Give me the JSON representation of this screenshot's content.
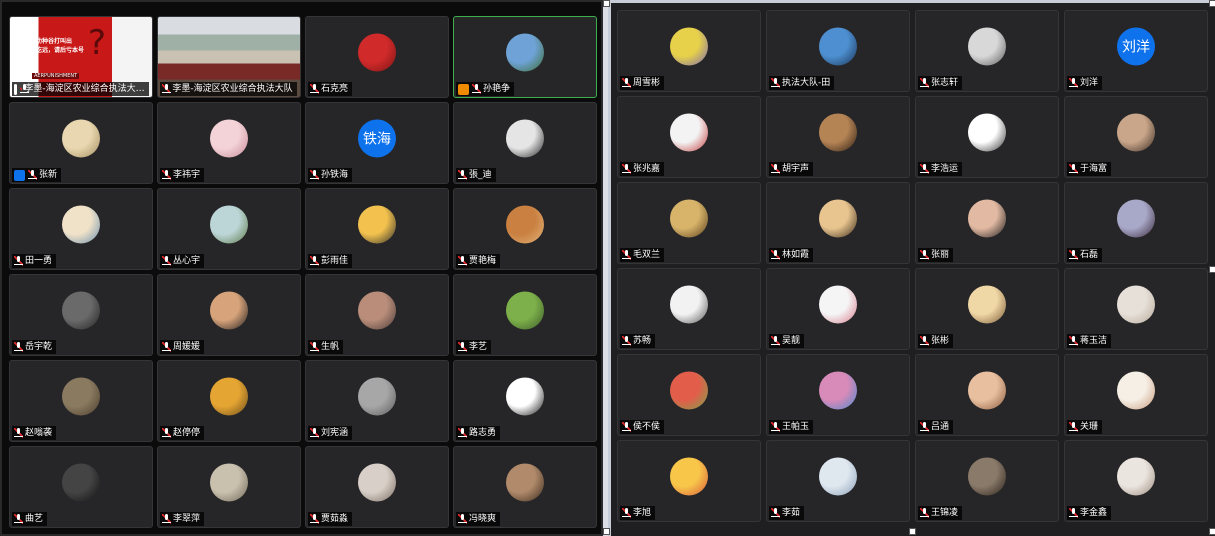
{
  "left_panel": {
    "tiles": [
      {
        "name": "李墨-海淀区农业综合执法大…",
        "avatar_type": "video_slide",
        "badge": "screen",
        "slide_text": "劝种谷打叫出\n吃远，请后亏本号",
        "slide_logo": "AERPUNISHMENT"
      },
      {
        "name": "李墨-海淀区农业综合执法大队",
        "avatar_type": "video_room"
      },
      {
        "name": "石克亮",
        "avatar_type": "photo",
        "colors": [
          "#d12a2a",
          "#7b1414"
        ]
      },
      {
        "name": "孙艳争",
        "avatar_type": "photo",
        "colors": [
          "#6fa3d8",
          "#3b6b2f"
        ],
        "badge": "orange",
        "active": true
      },
      {
        "name": "张新",
        "avatar_type": "photo",
        "colors": [
          "#e8d7b0",
          "#a58d5f"
        ],
        "badge": "blue"
      },
      {
        "name": "李祎宇",
        "avatar_type": "photo",
        "colors": [
          "#f3d3d8",
          "#c98a97"
        ]
      },
      {
        "name": "孙铁海",
        "avatar_type": "text",
        "avatar_text": "铁海"
      },
      {
        "name": "張_迪",
        "avatar_type": "photo",
        "colors": [
          "#e5e5e5",
          "#222222"
        ]
      },
      {
        "name": "田一勇",
        "avatar_type": "photo",
        "colors": [
          "#f0e2c8",
          "#6b8fae"
        ]
      },
      {
        "name": "丛心宇",
        "avatar_type": "photo",
        "colors": [
          "#bcd6d8",
          "#5c7a45"
        ]
      },
      {
        "name": "彭雨佳",
        "avatar_type": "photo",
        "colors": [
          "#f2c14e",
          "#2b2b2b"
        ]
      },
      {
        "name": "贾艳梅",
        "avatar_type": "photo",
        "colors": [
          "#c98040",
          "#e2b47a"
        ]
      },
      {
        "name": "岳宇乾",
        "avatar_type": "photo",
        "colors": [
          "#6a6a6a",
          "#222222"
        ]
      },
      {
        "name": "周媛媛",
        "avatar_type": "photo",
        "colors": [
          "#d7a37a",
          "#1e1e1e"
        ]
      },
      {
        "name": "生帆",
        "avatar_type": "photo",
        "colors": [
          "#b98d7a",
          "#4a3b38"
        ]
      },
      {
        "name": "李艺",
        "avatar_type": "photo",
        "colors": [
          "#7db04a",
          "#3d5a2a"
        ]
      },
      {
        "name": "赵嗡袭",
        "avatar_type": "photo",
        "colors": [
          "#8a7a60",
          "#4b3d2d"
        ]
      },
      {
        "name": "赵停停",
        "avatar_type": "photo",
        "colors": [
          "#e5a532",
          "#6a4b1c"
        ]
      },
      {
        "name": "刘宪涵",
        "avatar_type": "photo",
        "colors": [
          "#a7a7a7",
          "#5a5a5a"
        ]
      },
      {
        "name": "路志勇",
        "avatar_type": "photo",
        "colors": [
          "#ffffff",
          "#111111"
        ]
      },
      {
        "name": "曲艺",
        "avatar_type": "photo",
        "colors": [
          "#444444",
          "#101010"
        ]
      },
      {
        "name": "李翠萍",
        "avatar_type": "photo",
        "colors": [
          "#c9c0ae",
          "#6e6656"
        ]
      },
      {
        "name": "贾茹淼",
        "avatar_type": "photo",
        "colors": [
          "#d8d0c8",
          "#7a6b63"
        ]
      },
      {
        "name": "冯晓爽",
        "avatar_type": "photo",
        "colors": [
          "#b08a6a",
          "#3a2a1e"
        ]
      }
    ]
  },
  "right_panel": {
    "tiles": [
      {
        "name": "周雪彬",
        "avatar_type": "photo",
        "colors": [
          "#e7d14a",
          "#7a68b0"
        ]
      },
      {
        "name": "执法大队-田",
        "avatar_type": "photo",
        "colors": [
          "#4d8fd0",
          "#1a3355"
        ]
      },
      {
        "name": "张志轩",
        "avatar_type": "photo",
        "colors": [
          "#d8d8d8",
          "#5a5a5a"
        ]
      },
      {
        "name": "刘洋",
        "avatar_type": "text",
        "avatar_text": "刘洋"
      },
      {
        "name": "张兆嘉",
        "avatar_type": "photo",
        "colors": [
          "#f3f3f3",
          "#c23a3a"
        ]
      },
      {
        "name": "胡宇声",
        "avatar_type": "photo",
        "colors": [
          "#b58455",
          "#2a1c12"
        ]
      },
      {
        "name": "李浩运",
        "avatar_type": "photo",
        "colors": [
          "#ffffff",
          "#333333"
        ]
      },
      {
        "name": "于海富",
        "avatar_type": "photo",
        "colors": [
          "#c9a68a",
          "#3a2c22"
        ]
      },
      {
        "name": "毛双兰",
        "avatar_type": "photo",
        "colors": [
          "#d8b46a",
          "#5a3f1e"
        ]
      },
      {
        "name": "林如霞",
        "avatar_type": "photo",
        "colors": [
          "#e8c58f",
          "#3a2a1a"
        ]
      },
      {
        "name": "张丽",
        "avatar_type": "photo",
        "colors": [
          "#e2b9a2",
          "#1b1b1b"
        ]
      },
      {
        "name": "石磊",
        "avatar_type": "photo",
        "colors": [
          "#a8a8c8",
          "#3b2a3a"
        ]
      },
      {
        "name": "苏畅",
        "avatar_type": "photo",
        "colors": [
          "#f2f2f2",
          "#555555"
        ]
      },
      {
        "name": "吴靓",
        "avatar_type": "photo",
        "colors": [
          "#f5f5f5",
          "#d67a8a"
        ]
      },
      {
        "name": "张彬",
        "avatar_type": "photo",
        "colors": [
          "#f0d7a6",
          "#7a5a35"
        ]
      },
      {
        "name": "蒋玉洁",
        "avatar_type": "photo",
        "colors": [
          "#e6e0d8",
          "#b8a89a"
        ]
      },
      {
        "name": "侯不侯",
        "avatar_type": "photo",
        "colors": [
          "#e25e4a",
          "#7aa34a"
        ]
      },
      {
        "name": "王帕玉",
        "avatar_type": "photo",
        "colors": [
          "#d88ab8",
          "#4a8ad0"
        ]
      },
      {
        "name": "吕通",
        "avatar_type": "photo",
        "colors": [
          "#e8c0a0",
          "#8a5a3a"
        ]
      },
      {
        "name": "关珊",
        "avatar_type": "photo",
        "colors": [
          "#f6efe6",
          "#c89a7a"
        ]
      },
      {
        "name": "李旭",
        "avatar_type": "photo",
        "colors": [
          "#f8c74a",
          "#d85a3a"
        ]
      },
      {
        "name": "李茹",
        "avatar_type": "photo",
        "colors": [
          "#dfe7ef",
          "#8aa0b8"
        ]
      },
      {
        "name": "王锦凌",
        "avatar_type": "photo",
        "colors": [
          "#8a7a6a",
          "#2a221a"
        ]
      },
      {
        "name": "李金鑫",
        "avatar_type": "photo",
        "colors": [
          "#ebe5df",
          "#9a8a7e"
        ]
      }
    ]
  }
}
